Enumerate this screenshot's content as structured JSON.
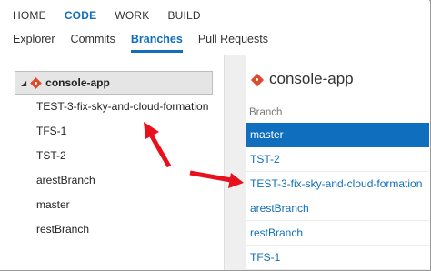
{
  "topnav": {
    "items": [
      {
        "label": "HOME",
        "active": false
      },
      {
        "label": "CODE",
        "active": true
      },
      {
        "label": "WORK",
        "active": false
      },
      {
        "label": "BUILD",
        "active": false
      }
    ]
  },
  "subnav": {
    "items": [
      {
        "label": "Explorer",
        "active": false
      },
      {
        "label": "Commits",
        "active": false
      },
      {
        "label": "Branches",
        "active": true
      },
      {
        "label": "Pull Requests",
        "active": false
      }
    ]
  },
  "left": {
    "repo_name": "console-app",
    "branches": [
      "TEST-3-fix-sky-and-cloud-formation",
      "TFS-1",
      "TST-2",
      "arestBranch",
      "master",
      "restBranch"
    ]
  },
  "right": {
    "title": "console-app",
    "column_header": "Branch",
    "branches": [
      {
        "name": "master",
        "selected": true
      },
      {
        "name": "TST-2",
        "selected": false
      },
      {
        "name": "TEST-3-fix-sky-and-cloud-formation",
        "selected": false
      },
      {
        "name": "arestBranch",
        "selected": false
      },
      {
        "name": "restBranch",
        "selected": false
      },
      {
        "name": "TFS-1",
        "selected": false
      }
    ]
  },
  "colors": {
    "accent": "#106ebe",
    "git_icon": "#e0492e",
    "annotation_arrow": "#e8101c"
  },
  "icons": [
    "git-repo-icon",
    "collapse-caret-icon",
    "annotation-arrow"
  ]
}
